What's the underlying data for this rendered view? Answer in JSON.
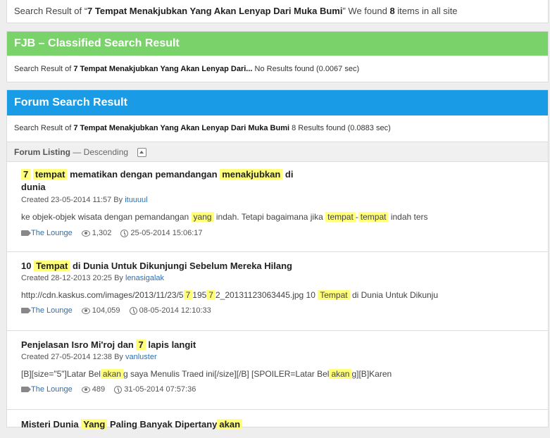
{
  "top": {
    "prefix": "Search Result of “",
    "query": "7 Tempat Menakjubkan Yang Akan Lenyap Dari Muka Bumi",
    "mid": "” We found ",
    "count": "8",
    "suffix": " items in all site"
  },
  "fjb": {
    "heading": "FJB – Classified Search Result",
    "sub_prefix": "Search Result of ",
    "sub_query": "7 Tempat Menakjubkan Yang Akan Lenyap Dari...",
    "sub_result": " No Results found (0.0067 sec)"
  },
  "forum": {
    "heading": "Forum Search Result",
    "sub_prefix": "Search Result of ",
    "sub_query": "7 Tempat Menakjubkan Yang Akan Lenyap Dari Muka Bumi",
    "sub_result": " 8 Results found (0.0883 sec)",
    "listing_label": "Forum Listing",
    "listing_order": " — Descending"
  },
  "results": [
    {
      "title_parts": [
        {
          "t": "7",
          "hl": true
        },
        {
          "t": " ",
          "hl": false
        },
        {
          "t": "tempat",
          "hl": true
        },
        {
          "t": " mematikan dengan pemandangan ",
          "hl": false
        },
        {
          "t": "menakjubkan",
          "hl": true
        },
        {
          "t": " di",
          "hl": false
        },
        {
          "t": "\ndunia",
          "hl": false
        }
      ],
      "created": "Created 23-05-2014 11:57 By ",
      "author": "ituuuul",
      "snippet_parts": [
        {
          "t": "ke objek-objek wisata dengan pemandangan ",
          "hl": false
        },
        {
          "t": "yang",
          "hl": true
        },
        {
          "t": " indah. Tetapi bagaimana jika ",
          "hl": false
        },
        {
          "t": "tempat",
          "hl": true
        },
        {
          "t": "-",
          "hl": false
        },
        {
          "t": "tempat",
          "hl": true
        },
        {
          "t": " indah ters",
          "hl": false
        }
      ],
      "forum": "The Lounge",
      "views": "1,302",
      "last": "25-05-2014 15:06:17"
    },
    {
      "title_parts": [
        {
          "t": "10 ",
          "hl": false
        },
        {
          "t": "Tempat",
          "hl": true
        },
        {
          "t": " di Dunia Untuk Dikunjungi Sebelum Mereka Hilang",
          "hl": false
        }
      ],
      "created": "Created 28-12-2013 20:25 By ",
      "author": "lenasigalak",
      "snippet_parts": [
        {
          "t": "http://cdn.kaskus.com/images/2013/11/23/5",
          "hl": false
        },
        {
          "t": "7",
          "hl": true
        },
        {
          "t": "195",
          "hl": false
        },
        {
          "t": "7",
          "hl": true
        },
        {
          "t": "2_20131123063445.jpg 10 ",
          "hl": false
        },
        {
          "t": "Tempat",
          "hl": true
        },
        {
          "t": " di Dunia Untuk Dikunju",
          "hl": false
        }
      ],
      "forum": "The Lounge",
      "views": "104,059",
      "last": "08-05-2014 12:10:33"
    },
    {
      "title_parts": [
        {
          "t": "Penjelasan Isro Mi'roj dan ",
          "hl": false
        },
        {
          "t": "7",
          "hl": true
        },
        {
          "t": " lapis langit",
          "hl": false
        }
      ],
      "created": "Created 27-05-2014 12:38 By ",
      "author": "vanluster",
      "snippet_parts": [
        {
          "t": "[B][size=\"5\"]Latar Bel",
          "hl": false
        },
        {
          "t": "akan",
          "hl": true
        },
        {
          "t": "g saya Menulis Traed ini[/size][/B] [SPOILER=Latar Bel",
          "hl": false
        },
        {
          "t": "akan",
          "hl": true
        },
        {
          "t": "g][B]Karen",
          "hl": false
        }
      ],
      "forum": "The Lounge",
      "views": "489",
      "last": "31-05-2014 07:57:36"
    },
    {
      "title_parts": [
        {
          "t": "Misteri Dunia ",
          "hl": false
        },
        {
          "t": "Yang",
          "hl": true
        },
        {
          "t": " Paling Banyak Dipertany",
          "hl": false
        },
        {
          "t": "akan",
          "hl": true
        }
      ]
    }
  ],
  "icons": {
    "forum": "tag-icon",
    "views": "eye-icon",
    "last_post": "clock-icon",
    "sort": "sort-ascending-icon"
  },
  "colors": {
    "fjb_header": "#7ad26a",
    "forum_header": "#1a9be6",
    "highlight": "#ffff7a",
    "link": "#2a6fb4"
  }
}
